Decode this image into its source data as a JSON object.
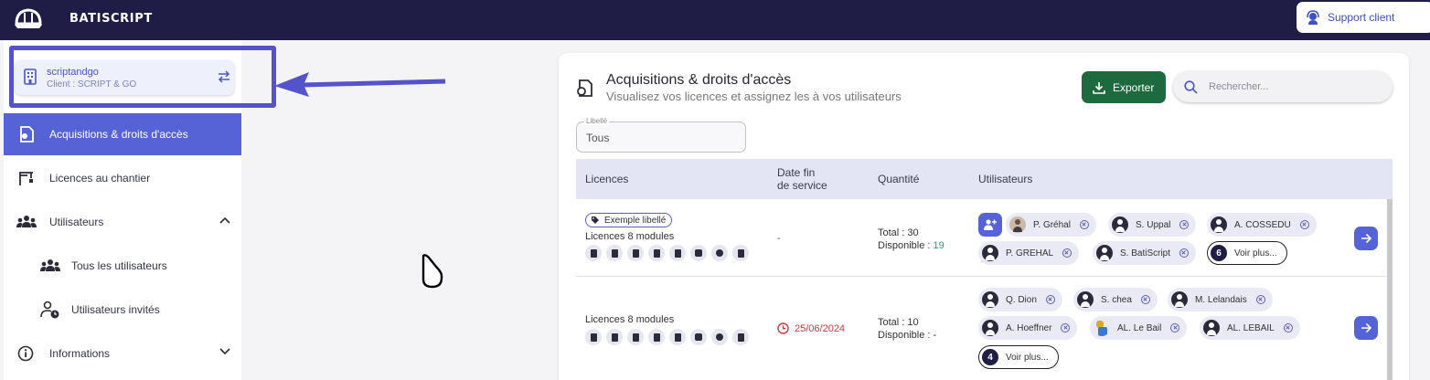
{
  "app": {
    "brand": "BATISCRIPT",
    "support_label": "Support client"
  },
  "client": {
    "name": "scriptandgo",
    "subtitle": "Client : SCRIPT & GO"
  },
  "sidebar": {
    "items": [
      {
        "label": "Acquisitions & droits d'accès",
        "active": true
      },
      {
        "label": "Licences au chantier"
      },
      {
        "label": "Utilisateurs",
        "expanded": true
      },
      {
        "label": "Tous les utilisateurs"
      },
      {
        "label": "Utilisateurs invités"
      },
      {
        "label": "Informations",
        "expanded": false
      }
    ]
  },
  "page": {
    "title": "Acquisitions & droits d'accès",
    "subtitle": "Visualisez vos licences et assignez les à vos utilisateurs",
    "export_label": "Exporter",
    "search_placeholder": "Rechercher..."
  },
  "filter": {
    "label": "Libellé",
    "value": "Tous"
  },
  "table": {
    "headers": {
      "licences": "Licences",
      "date_line1": "Date fin",
      "date_line2": "de service",
      "quantite": "Quantité",
      "utilisateurs": "Utilisateurs"
    },
    "rows": [
      {
        "tag": "Exemple libellé",
        "licence": "Licences 8 modules",
        "date": "-",
        "total": "Total : 30",
        "disponible_label": "Disponible : ",
        "disponible_value": "19",
        "users": [
          "P. Gréhal",
          "S. Uppal",
          "A. COSSEDU",
          "P. GREHAL",
          "S. BatiScript"
        ],
        "more_count": "6",
        "more_label": "Voir plus..."
      },
      {
        "licence": "Licences 8 modules",
        "date": "25/06/2024",
        "total": "Total : 10",
        "disponible_label": "Disponible : -",
        "users": [
          "Q. Dion",
          "S. chea",
          "M. Lelandais",
          "A. Hoeffner",
          "AL. Le Bail",
          "AL. LEBAIL"
        ],
        "more_count": "4",
        "more_label": "Voir plus..."
      }
    ]
  },
  "colors": {
    "topbar": "#1f1d45",
    "accent": "#5663d6",
    "export": "#1e6a3f",
    "available": "#1ea36b",
    "expired": "#d9363e"
  }
}
